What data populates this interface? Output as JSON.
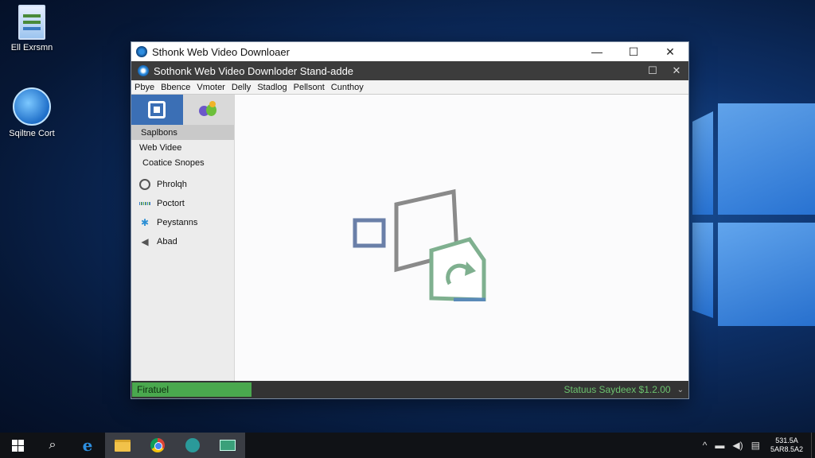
{
  "desktop": {
    "icons": [
      {
        "label": "Ell Exrsmn"
      },
      {
        "label": "Sqiltne Cort"
      }
    ]
  },
  "window": {
    "title": "Sthonk Web Video Downloaer",
    "controls": {
      "minimize": "—",
      "maximize": "☐",
      "close": "✕"
    }
  },
  "app": {
    "title": "Sothonk Web Video Downloder Stand-adde",
    "controls": {
      "restore": "☐",
      "close": "✕"
    },
    "menu": [
      "Pbye",
      "Bbence",
      "Vmoter",
      "Delly",
      "Stadlog",
      "Pellsont",
      "Cunthoy"
    ],
    "sidebar": {
      "header_items": [
        "Saplbons",
        "Web Videe",
        "Coatice Snopes"
      ],
      "nav": [
        {
          "label": "Phrolqh",
          "icon": "circle-icon"
        },
        {
          "label": "Poctort",
          "icon": "grid-icon"
        },
        {
          "label": "Peystanns",
          "icon": "star-icon"
        },
        {
          "label": "Abad",
          "icon": "back-arrow-icon"
        }
      ]
    },
    "status": {
      "left": "Firatuel",
      "right": "Statuus Saydeex $1.2.00",
      "caret": "⌄"
    }
  },
  "taskbar": {
    "search_icon": "⌕",
    "tray": {
      "chevron": "^",
      "clock_line1": "531.5A",
      "clock_line2": "5AR8.5A2"
    }
  },
  "colors": {
    "status_green": "#4aa84e",
    "sidebar_tab_active": "#3b6fb5",
    "inner_titlebar": "#3c3c3c"
  }
}
